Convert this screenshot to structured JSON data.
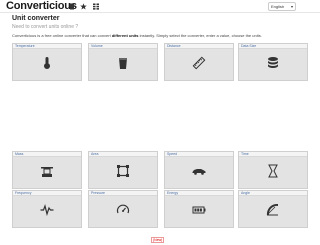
{
  "header": {
    "logo": "Converticious",
    "language": "English"
  },
  "main": {
    "title": "Unit converter",
    "subtitle": "Need to convert units online ?",
    "intro_before": "Converticious is a free online converter that can convert ",
    "intro_bold": "different units",
    "intro_after": " instantly. Simply select the converter, enter a value, choose the units."
  },
  "cards": [
    {
      "label": "Temperature",
      "icon": "thermometer-icon"
    },
    {
      "label": "Volume",
      "icon": "glass-icon"
    },
    {
      "label": "Distance",
      "icon": "ruler-icon"
    },
    {
      "label": "Data Size",
      "icon": "database-icon"
    },
    {
      "label": "Mass",
      "icon": "scale-icon"
    },
    {
      "label": "Area",
      "icon": "area-icon"
    },
    {
      "label": "Speed",
      "icon": "car-icon"
    },
    {
      "label": "Time",
      "icon": "clock-icon"
    },
    {
      "label": "Frequency",
      "icon": "waveform-icon"
    },
    {
      "label": "Pressure",
      "icon": "gauge-icon"
    },
    {
      "label": "Energy",
      "icon": "battery-icon"
    },
    {
      "label": "Angle",
      "icon": "protractor-icon"
    }
  ],
  "footer": {
    "badge": "(New)"
  }
}
